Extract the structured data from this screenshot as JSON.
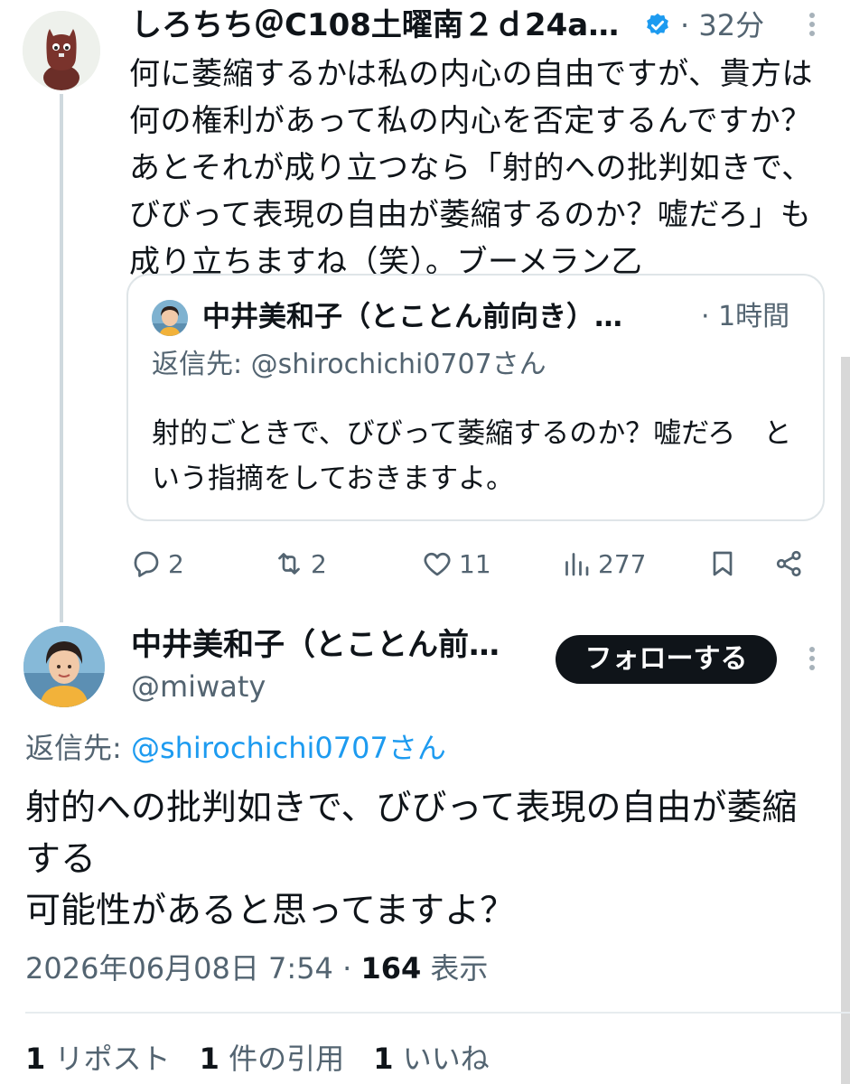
{
  "colors": {
    "accent": "#1d9bf0",
    "text": "#0f1419",
    "muted": "#536471",
    "border": "#dfe5e8",
    "follow_bg": "#0f1419"
  },
  "reply_tweet": {
    "author_name": "しろちち＠C108土曜南２ｄ24a／…",
    "verified_icon": "verified-badge-icon",
    "time": "· 32分",
    "text": "何に萎縮するかは私の内心の自由ですが、貴方は何の権利があって私の内心を否定するんですか？あとそれが成り立つなら「射的への批判如きで、びびって表現の自由が萎縮するのか？嘘だろ」も成り立ちますね（笑）。ブーメラン乙",
    "quoted": {
      "author_name": "中井美和子（とことん前向き）…",
      "time": "· 1時間",
      "reply_to": "返信先: @shirochichi0707さん",
      "text": "射的ごときで、びびって萎縮するのか？嘘だろ　という指摘をしておきますよ。"
    },
    "actions": {
      "replies": "2",
      "reposts": "2",
      "likes": "11",
      "views": "277"
    }
  },
  "main_tweet": {
    "author_name": "中井美和子（とことん前…",
    "handle": "@miwaty",
    "follow_label": "フォローする",
    "reply_to_label": "返信先: ",
    "reply_to_mention": "@shirochichi0707さん",
    "text": "射的への批判如きで、びびって表現の自由が萎縮する\n可能性があると思ってますよ？",
    "timestamp": "2026年06月08日 7:54 · ",
    "views_count": "164",
    "views_label": " 表示",
    "stats": {
      "reposts_num": "1",
      "reposts_label": " リポスト",
      "quotes_num": "1",
      "quotes_label": " 件の引用",
      "likes_num": "1",
      "likes_label": " いいね"
    }
  }
}
